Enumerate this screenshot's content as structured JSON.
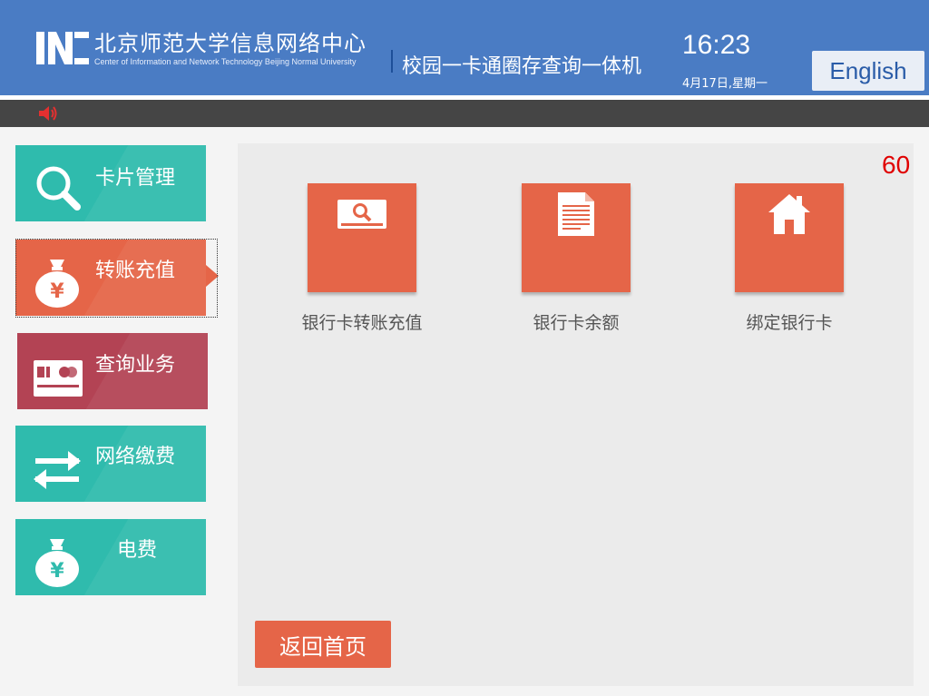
{
  "header": {
    "org_name_cn": "北京师范大学信息网络中心",
    "org_name_en": "Center of Information and Network Technology Beijing Normal University",
    "system_title": "校园一卡通圈存查询一体机",
    "time": "16:23",
    "date": "4月17日,星期一",
    "language_button": "English"
  },
  "sidebar": {
    "items": [
      {
        "label": "卡片管理",
        "icon": "magnifier-icon",
        "color": "#2fbbad"
      },
      {
        "label": "转账充值",
        "icon": "money-bag-icon",
        "color": "#e56548",
        "active": true
      },
      {
        "label": "查询业务",
        "icon": "bank-card-icon",
        "color": "#b34354"
      },
      {
        "label": "网络缴费",
        "icon": "transfer-arrows-icon",
        "color": "#2fbbad"
      },
      {
        "label": "电费",
        "icon": "money-bag-icon",
        "color": "#2fbbad"
      }
    ]
  },
  "main": {
    "countdown": "60",
    "tiles": [
      {
        "label": "银行卡转账充值",
        "icon": "card-magnifier-icon"
      },
      {
        "label": "银行卡余额",
        "icon": "document-icon"
      },
      {
        "label": "绑定银行卡",
        "icon": "home-icon"
      }
    ],
    "home_button": "返回首页"
  },
  "colors": {
    "header_bg": "#4a7cc4",
    "accent_orange": "#e56548",
    "accent_teal": "#2fbbad",
    "accent_crimson": "#b34354",
    "countdown": "#e00000"
  }
}
